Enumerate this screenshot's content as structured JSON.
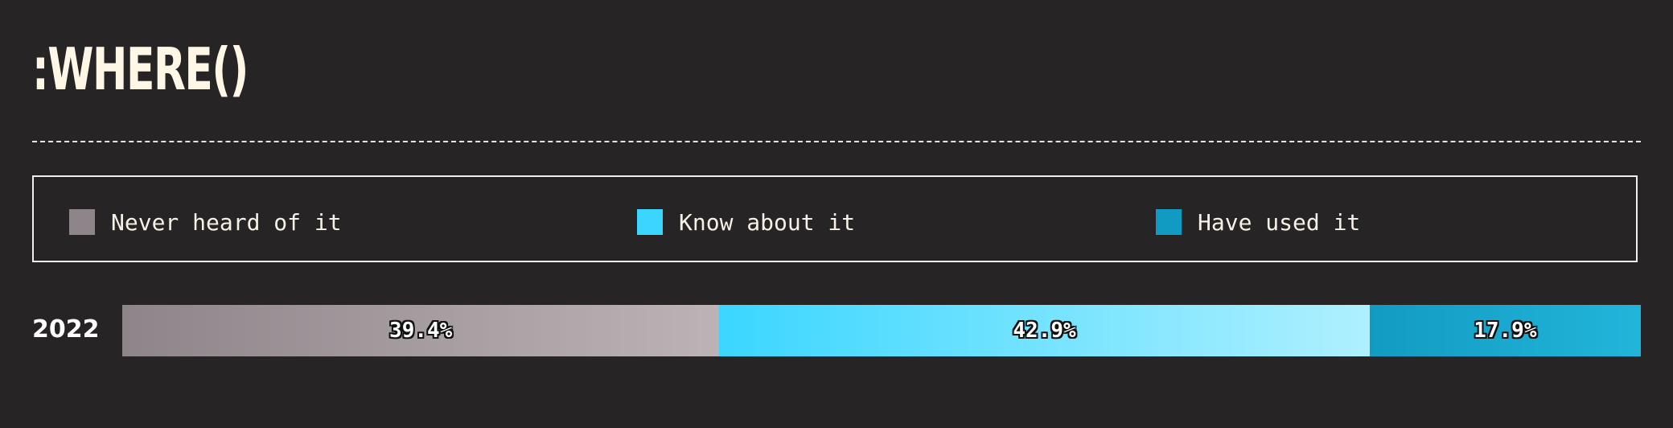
{
  "title": ":WHERE()",
  "chart_data": {
    "type": "bar",
    "orientation": "horizontal",
    "stacked": true,
    "normalized_percent": true,
    "categories": [
      "2022"
    ],
    "series": [
      {
        "name": "Never heard of it",
        "values": [
          39.4
        ],
        "color": "#8e858a",
        "color_end": "#bcb3b6"
      },
      {
        "name": "Know about it",
        "values": [
          42.9
        ],
        "color": "#3bd6ff",
        "color_end": "#aff0ff"
      },
      {
        "name": "Have used it",
        "values": [
          17.9
        ],
        "color": "#129bc2",
        "color_end": "#22b5da"
      }
    ],
    "value_labels": [
      "39.4%",
      "42.9%",
      "17.9%"
    ],
    "legend_position": "top",
    "grid": false
  }
}
